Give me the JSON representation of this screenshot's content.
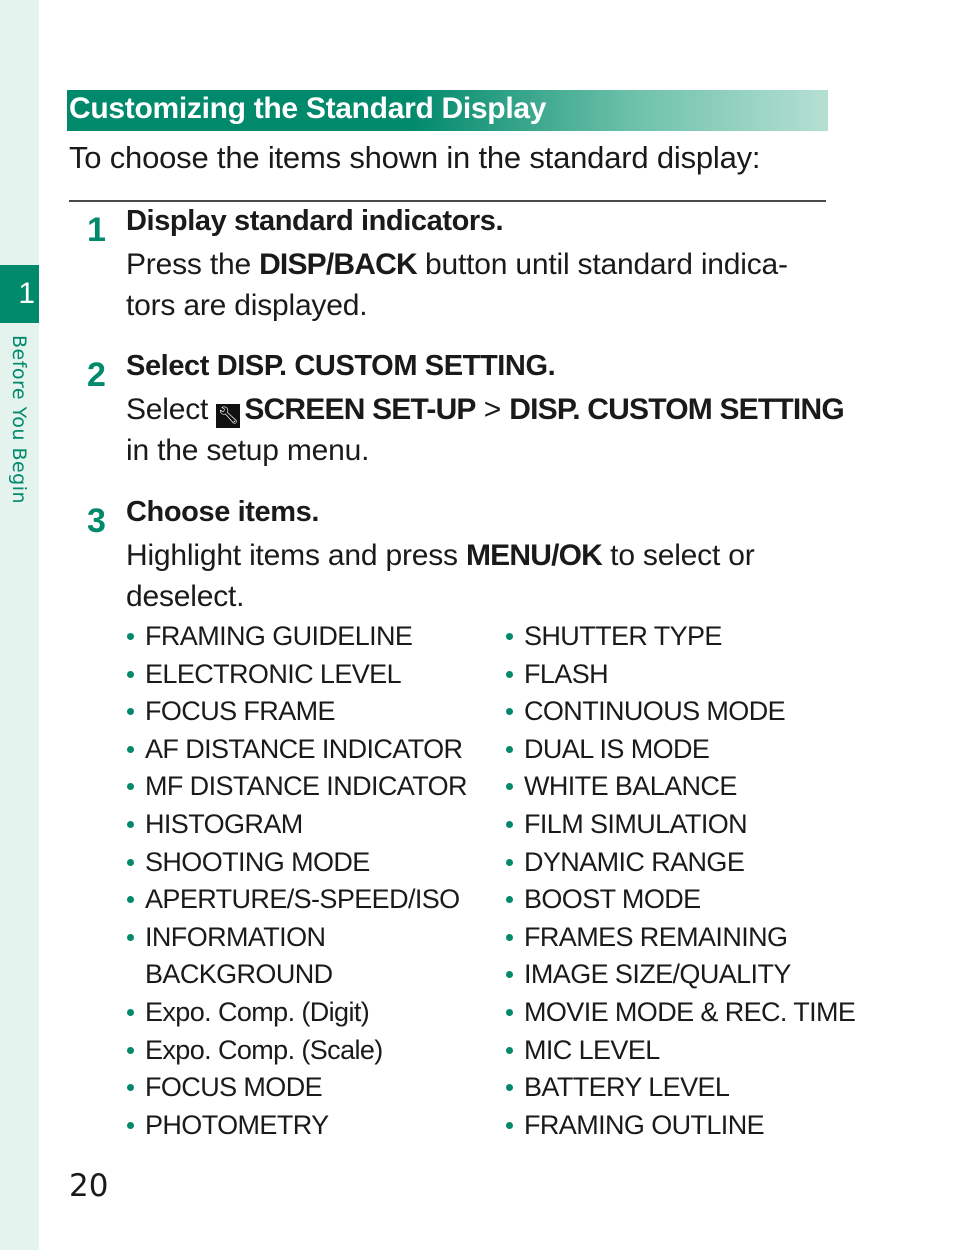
{
  "sidebar": {
    "chapter_number": "1",
    "chapter_title": "Before You Begin"
  },
  "section": {
    "title": "Customizing the Standard Display",
    "intro": "To choose the items shown in the standard display:"
  },
  "steps": [
    {
      "number": "1",
      "title": "Display standard indicators.",
      "body_pre": "Press the ",
      "body_keyword": "DISP/BACK",
      "body_post_line1": " button until standard indica-",
      "body_line2": "tors are displayed."
    },
    {
      "number": "2",
      "title_pre": "Select ",
      "title_keyword": "DISP. CUSTOM SETTING.",
      "body_pre": "Select ",
      "icon": "wrench-icon",
      "menu_path_1": "SCREEN SET-UP",
      "separator": " > ",
      "menu_path_2": "DISP. CUSTOM SETTING",
      "body_line2": "in the setup menu."
    },
    {
      "number": "3",
      "title": "Choose items.",
      "body_pre": "Highlight items and press ",
      "body_keyword": "MENU/OK",
      "body_post_line1": " to select or",
      "body_line2": "deselect."
    }
  ],
  "items_left": [
    "FRAMING GUIDELINE",
    "ELECTRONIC LEVEL",
    "FOCUS FRAME",
    "AF DISTANCE INDICATOR",
    "MF DISTANCE INDICATOR",
    "HISTOGRAM",
    "SHOOTING MODE",
    "APERTURE/S-SPEED/ISO",
    "INFORMATION BACKGROUND",
    "Expo. Comp. (Digit)",
    "Expo. Comp. (Scale)",
    "FOCUS MODE",
    "PHOTOMETRY"
  ],
  "items_left_wrapped": {
    "line1": "INFORMATION",
    "line2": "BACKGROUND"
  },
  "items_right": [
    "SHUTTER TYPE",
    "FLASH",
    "CONTINUOUS MODE",
    "DUAL IS MODE",
    "WHITE BALANCE",
    "FILM SIMULATION",
    "DYNAMIC RANGE",
    "BOOST MODE",
    "FRAMES REMAINING",
    "IMAGE SIZE/QUALITY",
    "MOVIE MODE & REC. TIME",
    "MIC LEVEL",
    "BATTERY LEVEL",
    "FRAMING OUTLINE"
  ],
  "page_number": "20",
  "colors": {
    "accent": "#00896b",
    "sidebar_bg": "#e4f3ee",
    "header_gradient_end": "#b5e0d3"
  }
}
